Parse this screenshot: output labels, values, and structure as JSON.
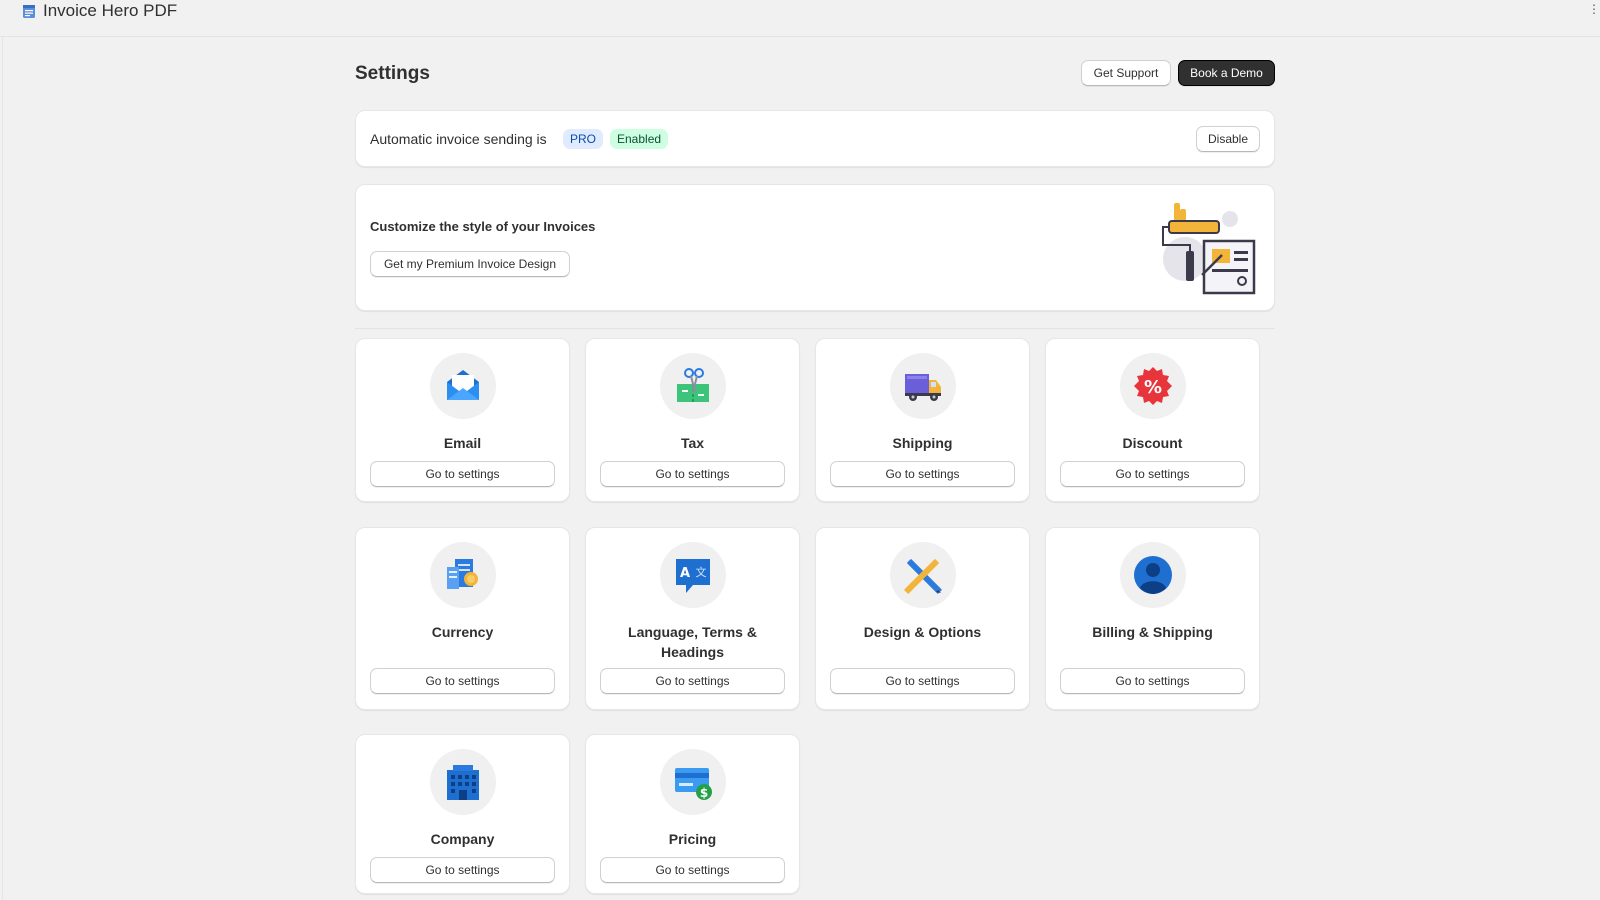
{
  "app": {
    "title": "Invoice Hero PDF",
    "kebab": "⋮"
  },
  "header": {
    "title": "Settings",
    "support_label": "Get Support",
    "demo_label": "Book a Demo"
  },
  "status": {
    "text": "Automatic invoice sending is",
    "pro_badge": "PRO",
    "enabled_badge": "Enabled",
    "disable_label": "Disable"
  },
  "promo": {
    "title": "Customize the style of your Invoices",
    "button_label": "Get my Premium Invoice Design"
  },
  "tiles": [
    {
      "label": "Email",
      "icon": "envelope-icon",
      "button": "Go to settings"
    },
    {
      "label": "Tax",
      "icon": "scissors-receipt-icon",
      "button": "Go to settings"
    },
    {
      "label": "Shipping",
      "icon": "truck-icon",
      "button": "Go to settings"
    },
    {
      "label": "Discount",
      "icon": "percent-badge-icon",
      "button": "Go to settings"
    },
    {
      "label": "Currency",
      "icon": "currency-receipt-icon",
      "button": "Go to settings"
    },
    {
      "label": "Language, Terms & Headings",
      "icon": "translate-icon",
      "button": "Go to settings"
    },
    {
      "label": "Design & Options",
      "icon": "pencil-ruler-icon",
      "button": "Go to settings"
    },
    {
      "label": "Billing & Shipping",
      "icon": "user-circle-icon",
      "button": "Go to settings"
    },
    {
      "label": "Company",
      "icon": "building-icon",
      "button": "Go to settings"
    },
    {
      "label": "Pricing",
      "icon": "credit-card-dollar-icon",
      "button": "Go to settings"
    }
  ],
  "colors": {
    "primary_dark": "#303030",
    "pro_bg": "#e0ebff",
    "enabled_bg": "#cdfee1",
    "page_bg": "#f1f1f1"
  }
}
